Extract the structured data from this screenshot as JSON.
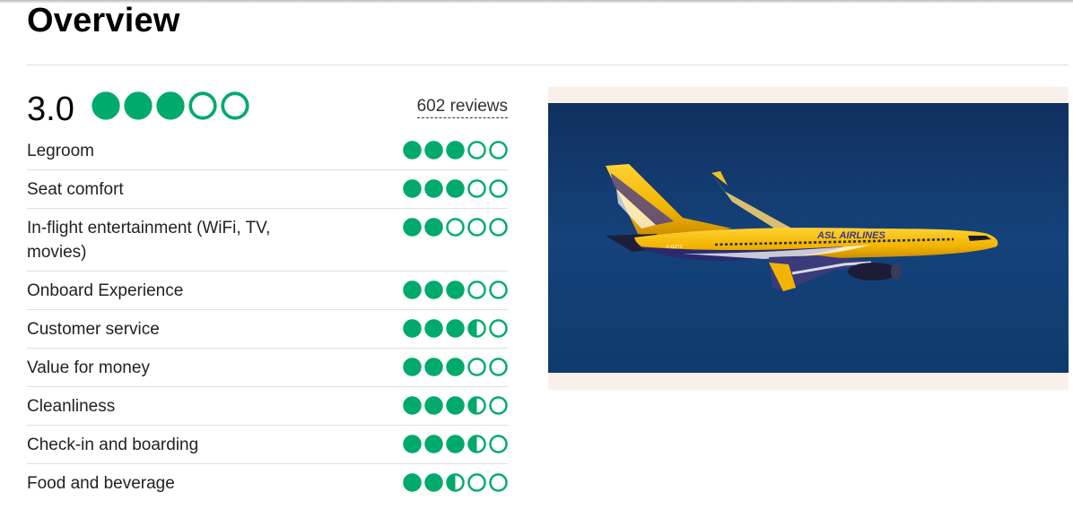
{
  "page": {
    "title": "Overview"
  },
  "summary": {
    "score": "3.0",
    "rating": 3.0,
    "reviews_label": "602 reviews"
  },
  "bubble_color": "#00aa6c",
  "ratings": [
    {
      "label": "Legroom",
      "rating": 3.0
    },
    {
      "label": "Seat comfort",
      "rating": 3.0
    },
    {
      "label": "In-flight entertainment (WiFi, TV, movies)",
      "rating": 2.0
    },
    {
      "label": "Onboard Experience",
      "rating": 3.0
    },
    {
      "label": "Customer service",
      "rating": 3.5
    },
    {
      "label": "Value for money",
      "rating": 3.0
    },
    {
      "label": "Cleanliness",
      "rating": 3.5
    },
    {
      "label": "Check-in and boarding",
      "rating": 3.5
    },
    {
      "label": "Food and beverage",
      "rating": 2.5
    }
  ],
  "photo": {
    "airline_logo_text": "ASL AIRLINES",
    "registration": "F-GZTC"
  }
}
